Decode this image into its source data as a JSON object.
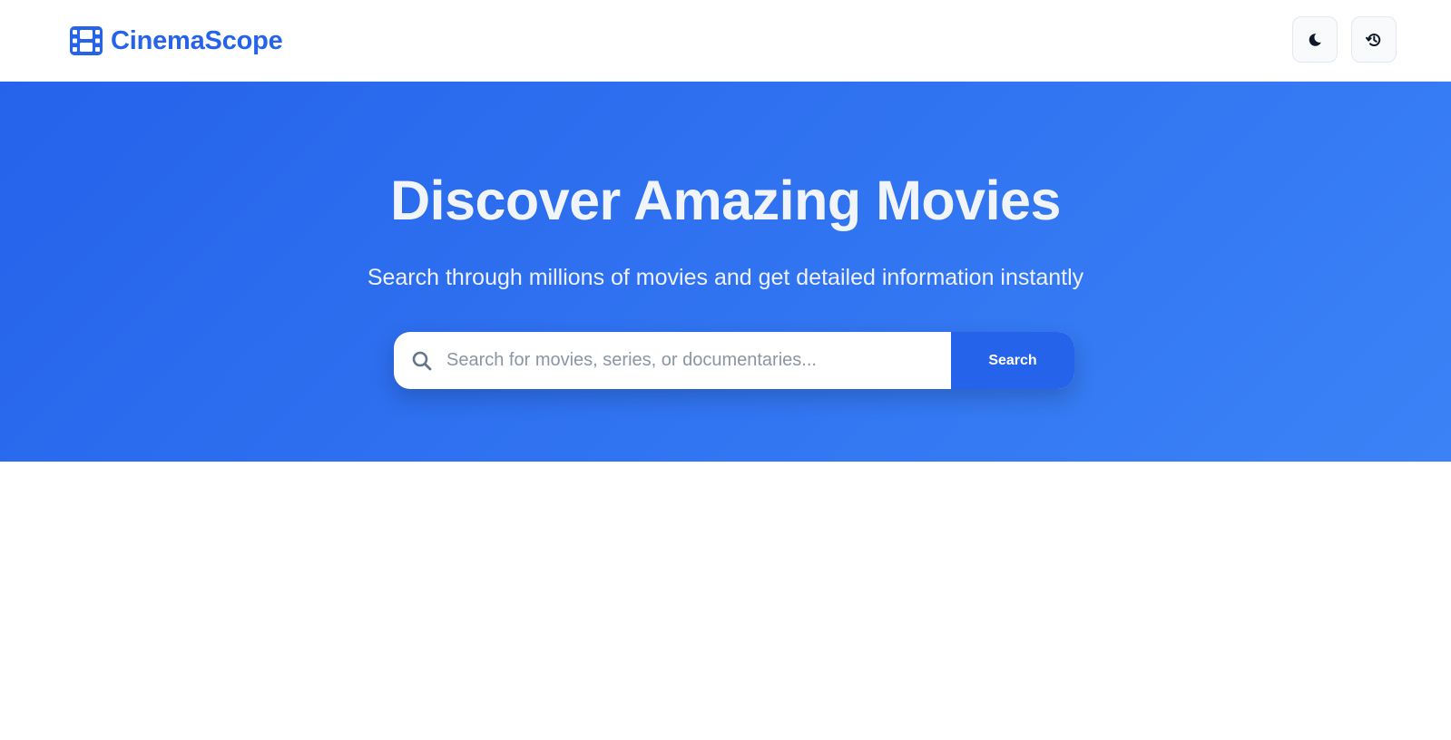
{
  "brand": {
    "name": "CinemaScope",
    "icon": "film-icon",
    "color": "#2563eb"
  },
  "nav": {
    "theme_toggle": {
      "icon": "moon-icon",
      "title": "Toggle dark mode"
    },
    "history": {
      "icon": "history-icon",
      "title": "Search history"
    }
  },
  "hero": {
    "title": "Discover Amazing Movies",
    "subtitle": "Search through millions of movies and get detailed information instantly",
    "gradient_start": "#2563eb",
    "gradient_end": "#3b82f6"
  },
  "search": {
    "icon": "search-icon",
    "value": "",
    "placeholder": "Search for movies, series, or documentaries...",
    "button_label": "Search"
  }
}
